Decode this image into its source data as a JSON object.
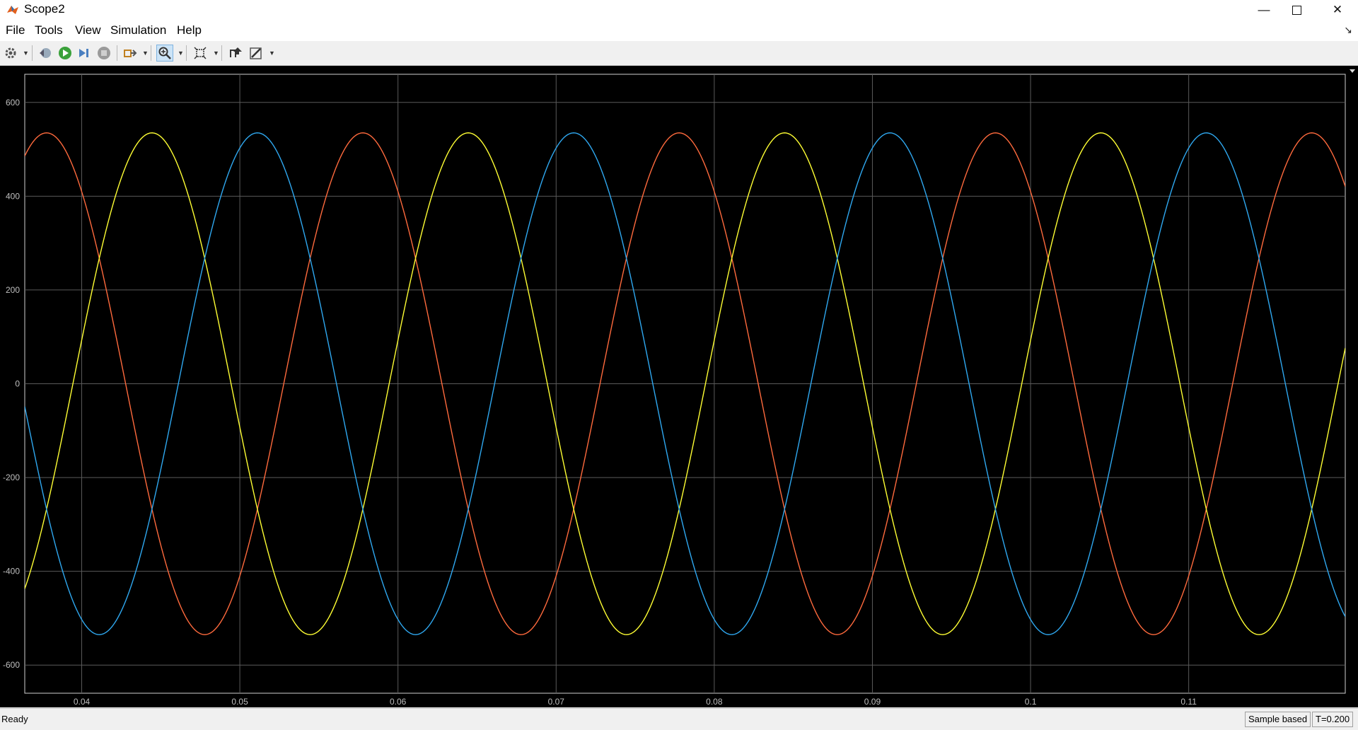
{
  "window": {
    "title": "Scope2"
  },
  "menu": {
    "items": [
      "File",
      "Tools",
      "View",
      "Simulation",
      "Help"
    ]
  },
  "status": {
    "left": "Ready",
    "mode": "Sample based",
    "time": "T=0.200"
  },
  "colors": {
    "series_a": "#ff6a3d",
    "series_b": "#ffff33",
    "series_c": "#2fa8f0",
    "grid": "#5a5a5a",
    "axes_bg": "#000000",
    "tick_text": "#bfbfbf"
  },
  "chart_data": {
    "type": "line",
    "title": "",
    "xlabel": "",
    "ylabel": "",
    "xlim": [
      0.0364,
      0.1199
    ],
    "ylim": [
      -660,
      660
    ],
    "xticks": [
      0.04,
      0.05,
      0.06,
      0.07,
      0.08,
      0.09,
      0.1,
      0.11
    ],
    "xtick_labels": [
      "0.04",
      "0.05",
      "0.06",
      "0.07",
      "0.08",
      "0.09",
      "0.1",
      "0.11"
    ],
    "yticks": [
      600,
      400,
      200,
      0,
      -200,
      -400,
      -600
    ],
    "ytick_labels": [
      "600",
      "400",
      "200",
      "0",
      "-200",
      "-400",
      "-600"
    ],
    "grid": true,
    "legend": "none",
    "series": [
      {
        "amplitude": 535,
        "frequency_hz": 50,
        "phase_deg": 130,
        "color": "#ff6a3d",
        "peaks_x": [
          0.0372,
          0.0572,
          0.0772,
          0.0972,
          0.1172
        ]
      },
      {
        "amplitude": 535,
        "frequency_hz": 50,
        "phase_deg": 10,
        "color": "#ffff33",
        "peaks_x": [
          0.0439,
          0.0639,
          0.0839,
          0.1039
        ]
      },
      {
        "amplitude": 535,
        "frequency_hz": 50,
        "phase_deg": -110,
        "color": "#2fa8f0",
        "peaks_x": [
          0.0506,
          0.0706,
          0.0906,
          0.1106
        ]
      }
    ]
  }
}
